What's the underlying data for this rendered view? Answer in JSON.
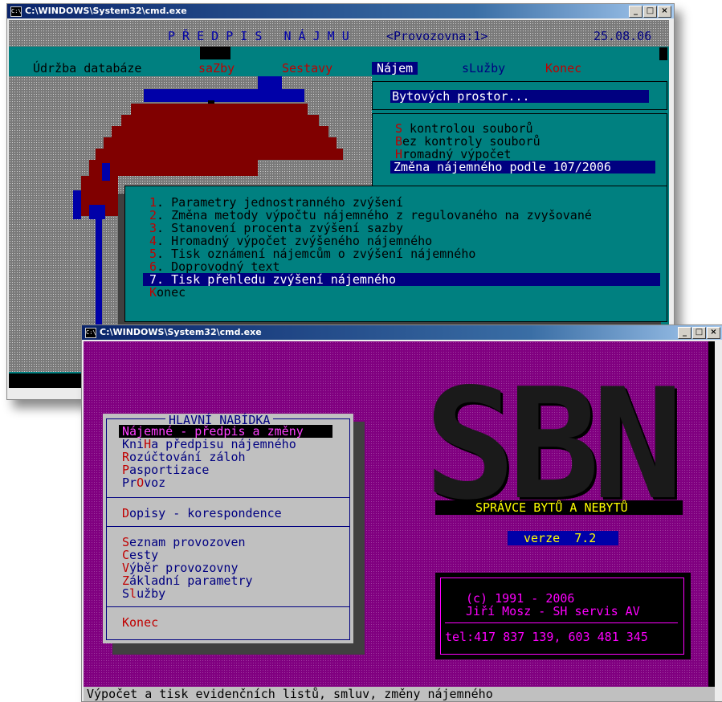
{
  "win1": {
    "title": "C:\\WINDOWS\\System32\\cmd.exe",
    "controls": [
      "_",
      "□",
      "×"
    ],
    "header_title": "P Ř E D P I S   N Á J M U",
    "header_org": "<Provozovna:1>",
    "header_date": "25.08.06",
    "menu": [
      "Údržba databáze",
      "saZby",
      "Sestavy",
      "Nájem",
      "sLužby",
      "Konec"
    ],
    "submenu1": [
      "Bytových prostor..."
    ],
    "submenu2": [
      "S kontrolou souborů",
      "Bez kontroly souborů",
      "Hromadný výpočet",
      "Změna nájemného podle 107/2006"
    ],
    "submenu3": [
      "1. Parametry jednostranného zvýšení",
      "2. Změna metody výpočtu nájemného z regulovaného na zvyšované",
      "3. Stanovení procenta zvýšení sazby",
      "4. Hromadný výpočet zvýšeného nájemného",
      "5. Tisk oznámení nájemcům o zvýšení nájemného",
      "6. Doprovodný text",
      "7. Tisk přehledu zvýšení nájemného",
      "Konec"
    ]
  },
  "win2": {
    "title": "C:\\WINDOWS\\System32\\cmd.exe",
    "controls": [
      "_",
      "□",
      "×"
    ],
    "menu_title": "HLAVNÍ NABÍDKA",
    "group1": [
      "Nájemné - předpis a změny",
      "KniHa předpisu nájemného",
      "Rozúčtování záloh",
      "Pasportizace",
      "PrOvoz"
    ],
    "group2": [
      "Dopisy - korespondence"
    ],
    "group3": [
      "Seznam provozoven",
      "Cesty",
      "Výběr provozovny",
      "Základní parametry",
      "Služby"
    ],
    "group4": [
      "Konec"
    ],
    "logo": "SBN",
    "product": "SPRÁVCE BYTŮ A NEBYTŮ",
    "version": "verze  7.2",
    "copyright": "(c) 1991 - 2006",
    "author": "Jiří Mosz - SH servis AV",
    "phone": "tel:417 837 139, 603 481 345",
    "status": "Výpočet a tisk evidenčních listů, smluv, změny nájemného"
  }
}
